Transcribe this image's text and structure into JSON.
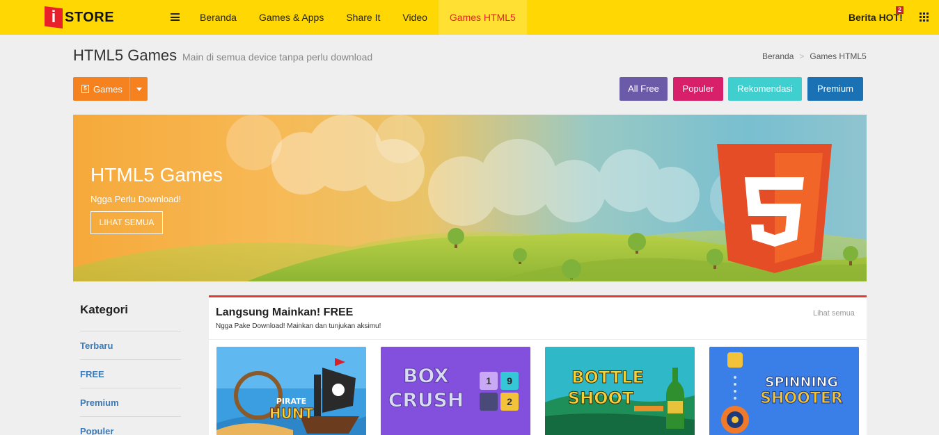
{
  "app": {
    "logo_letter": "i",
    "logo_text": "STORE"
  },
  "nav": {
    "items": [
      {
        "label": "Beranda"
      },
      {
        "label": "Games & Apps"
      },
      {
        "label": "Share It"
      },
      {
        "label": "Video"
      },
      {
        "label": "Games HTML5",
        "active": true
      }
    ],
    "berita_label": "Berita HOT!",
    "berita_count": "2"
  },
  "header": {
    "title": "HTML5 Games",
    "subtitle": "Main di semua device tanpa perlu download",
    "breadcrumb": [
      "Beranda",
      "Games HTML5"
    ]
  },
  "toolbar": {
    "dropdown_label": "Games",
    "filters": [
      {
        "label": "All Free",
        "color": "#6a5aa8"
      },
      {
        "label": "Populer",
        "color": "#d8206a"
      },
      {
        "label": "Rekomendasi",
        "color": "#3fcfcf"
      },
      {
        "label": "Premium",
        "color": "#1a72b5"
      }
    ]
  },
  "banner": {
    "title": "HTML5 Games",
    "subtitle": "Ngga Perlu Download!",
    "button_label": "LIHAT SEMUA",
    "logo_glyph": "5"
  },
  "sidebar": {
    "title": "Kategori",
    "items": [
      {
        "label": "Terbaru"
      },
      {
        "label": "FREE"
      },
      {
        "label": "Premium"
      },
      {
        "label": "Populer"
      }
    ]
  },
  "section": {
    "title": "Langsung Mainkan! FREE",
    "subtitle": "Ngga Pake Download! Mainkan dan tunjukan aksimu!",
    "link_label": "Lihat semua",
    "accent_color": "#e03b2c",
    "games": [
      {
        "title_top": "PIRATE",
        "title_bottom": "HUNT"
      },
      {
        "title_top": "BOX",
        "title_bottom": "CRUSH",
        "tiles": [
          "1",
          "9",
          "",
          "2"
        ]
      },
      {
        "title_top": "BOTTLE",
        "title_bottom": "SHOOT"
      },
      {
        "title_top": "SPINNING",
        "title_bottom": "SHOOTER"
      }
    ]
  }
}
